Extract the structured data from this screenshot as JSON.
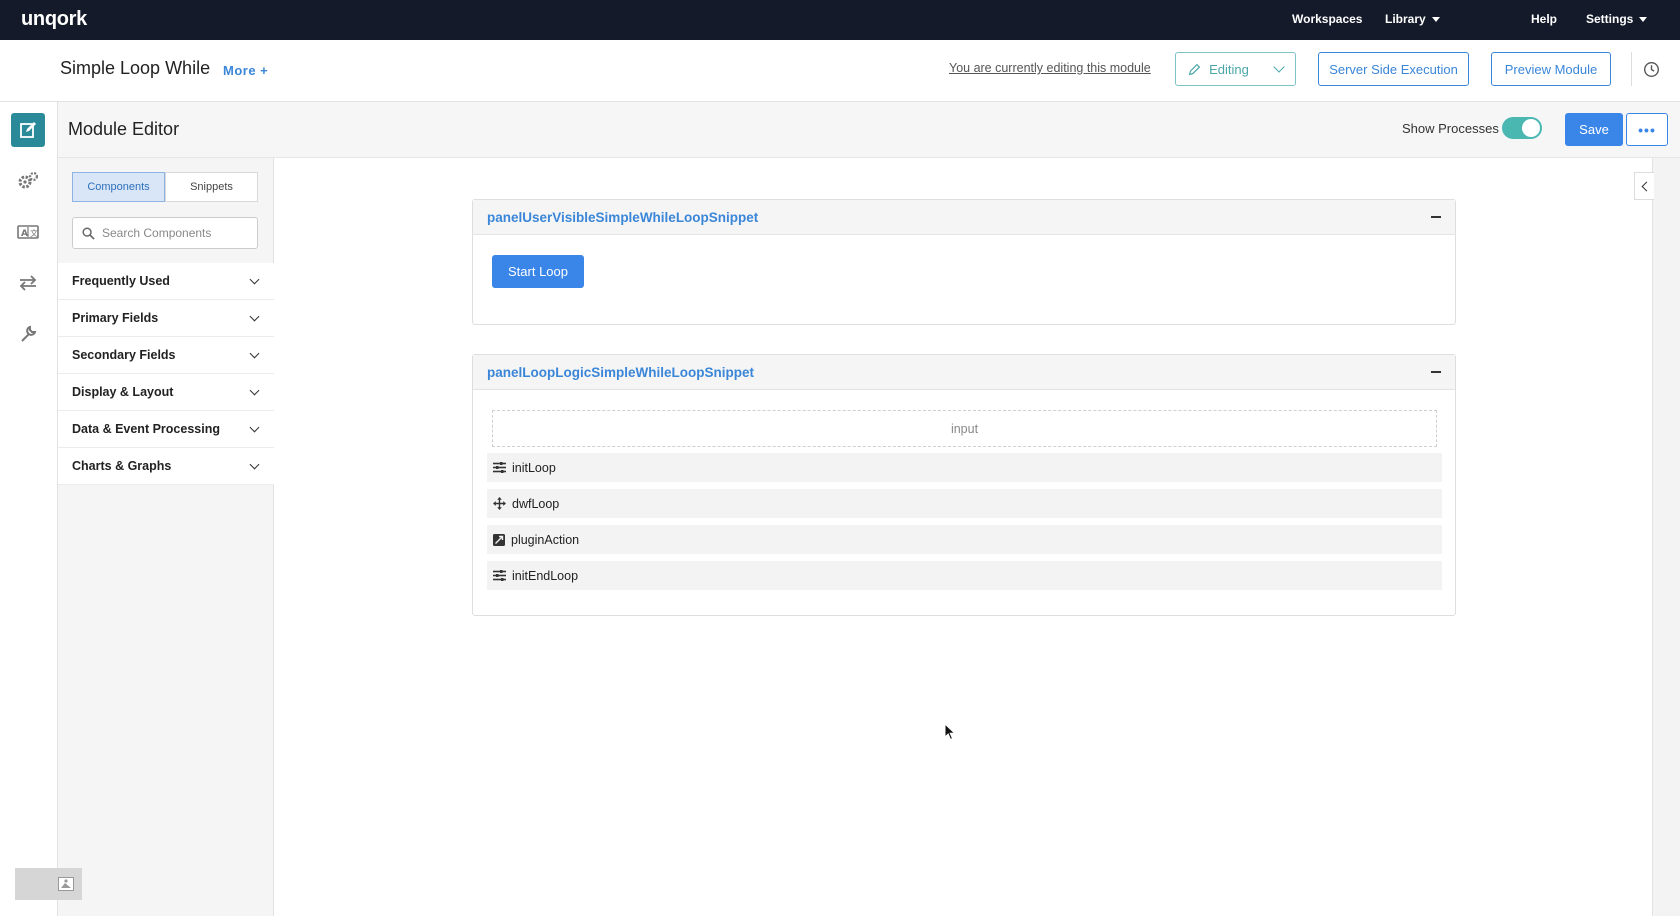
{
  "topnav": {
    "logo": "unqork",
    "items": [
      {
        "label": "Workspaces",
        "dropdown": false
      },
      {
        "label": "Library",
        "dropdown": true
      },
      {
        "label": "Help",
        "dropdown": false
      },
      {
        "label": "Settings",
        "dropdown": true
      }
    ]
  },
  "module": {
    "title": "Simple Loop While",
    "more_label": "More +",
    "editing_note": "You are currently editing this module",
    "editing_label": "Editing",
    "server_side_label": "Server Side Execution",
    "preview_label": "Preview Module"
  },
  "rail": {
    "icons": [
      "edit-icon",
      "gears-icon",
      "translate-icon",
      "transfer-icon",
      "wrench-icon"
    ],
    "active_color": "#2a8a9a"
  },
  "editor": {
    "title": "Module Editor",
    "show_processes_label": "Show Processes",
    "show_processes_on": true,
    "save_label": "Save",
    "more_label": "•••"
  },
  "sidebar": {
    "tabs": [
      {
        "label": "Components",
        "active": true
      },
      {
        "label": "Snippets",
        "active": false
      }
    ],
    "search_placeholder": "Search Components",
    "categories": [
      "Frequently Used",
      "Primary Fields",
      "Secondary Fields",
      "Display & Layout",
      "Data & Event Processing",
      "Charts & Graphs"
    ]
  },
  "canvas": {
    "panel_visible": {
      "title": "panelUserVisibleSimpleWhileLoopSnippet",
      "button_label": "Start Loop"
    },
    "panel_logic": {
      "title": "panelLoopLogicSimpleWhileLoopSnippet",
      "input_label": "input",
      "rows": [
        {
          "label": "initLoop",
          "icon": "initializer-icon"
        },
        {
          "label": "dwfLoop",
          "icon": "move-icon"
        },
        {
          "label": "pluginAction",
          "icon": "plugin-icon"
        },
        {
          "label": "initEndLoop",
          "icon": "initializer-icon"
        }
      ]
    }
  },
  "colors": {
    "nav_bg": "#141a29",
    "accent_blue": "#3a86e8",
    "toggle_teal": "#4ab7b0"
  }
}
